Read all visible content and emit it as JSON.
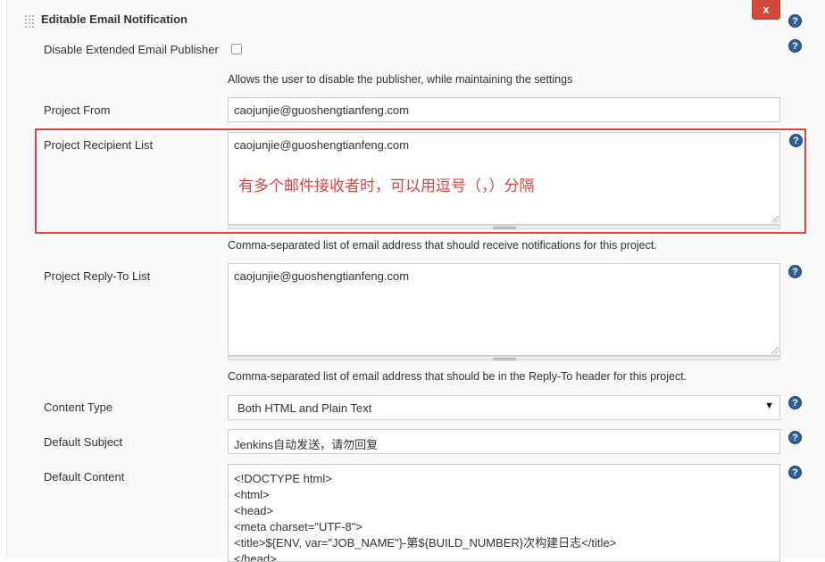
{
  "section": {
    "title": "Editable Email Notification",
    "close_label": "x"
  },
  "help_icon": "?",
  "disable_publisher": {
    "label": "Disable Extended Email Publisher",
    "checked": false,
    "description": "Allows the user to disable the publisher, while maintaining the settings"
  },
  "project_from": {
    "label": "Project From",
    "value": "caojunjie@guoshengtianfeng.com"
  },
  "recipient_list": {
    "label": "Project Recipient List",
    "value": "caojunjie@guoshengtianfeng.com",
    "annotation": "有多个邮件接收者时，可以用逗号（，）分隔",
    "description": "Comma-separated list of email address that should receive notifications for this project."
  },
  "reply_to": {
    "label": "Project Reply-To List",
    "value": "caojunjie@guoshengtianfeng.com",
    "description": "Comma-separated list of email address that should be in the Reply-To header for this project."
  },
  "content_type": {
    "label": "Content Type",
    "selected": "Both HTML and Plain Text"
  },
  "default_subject": {
    "label": "Default Subject",
    "value": "Jenkins自动发送，请勿回复"
  },
  "default_content": {
    "label": "Default Content",
    "lines": [
      "<!DOCTYPE html>",
      "<html>",
      "<head>",
      "<meta charset=\"UTF-8\">",
      "<title>${ENV, var=\"JOB_NAME\"}-第${BUILD_NUMBER}次构建日志</title>",
      "</head>"
    ]
  },
  "colors": {
    "close_button": "#d24939",
    "help_icon": "#2e5f9a",
    "annotation": "#e4413e"
  }
}
